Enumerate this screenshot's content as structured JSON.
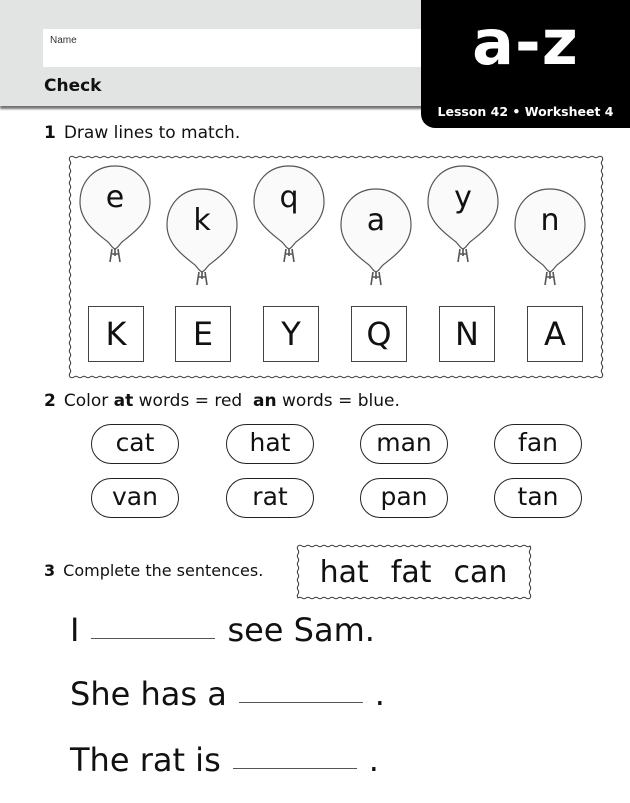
{
  "header": {
    "name_label": "Name",
    "title": "Check",
    "badge_title": "a-z",
    "badge_subtitle": "Lesson 42 • Worksheet 4"
  },
  "q1": {
    "number": "1",
    "instruction": "Draw lines to match.",
    "balloons": [
      "e",
      "k",
      "q",
      "a",
      "y",
      "n"
    ],
    "capitals": [
      "K",
      "E",
      "Y",
      "Q",
      "N",
      "A"
    ]
  },
  "q2": {
    "number": "2",
    "instruction_prefix": "Color",
    "at_word": "at",
    "instruction_mid": "words = red",
    "an_word": "an",
    "instruction_suffix": "words = blue.",
    "colors": {
      "at": "red",
      "an": "blue"
    },
    "words_row1": [
      "cat",
      "hat",
      "man",
      "fan"
    ],
    "words_row2": [
      "van",
      "rat",
      "pan",
      "tan"
    ]
  },
  "q3": {
    "number": "3",
    "instruction": "Complete the sentences.",
    "word_bank": [
      "hat",
      "fat",
      "can"
    ],
    "sentences": [
      {
        "before": "I",
        "after": "see Sam."
      },
      {
        "before": "She has a",
        "after": "."
      },
      {
        "before": "The rat is",
        "after": "."
      }
    ]
  }
}
